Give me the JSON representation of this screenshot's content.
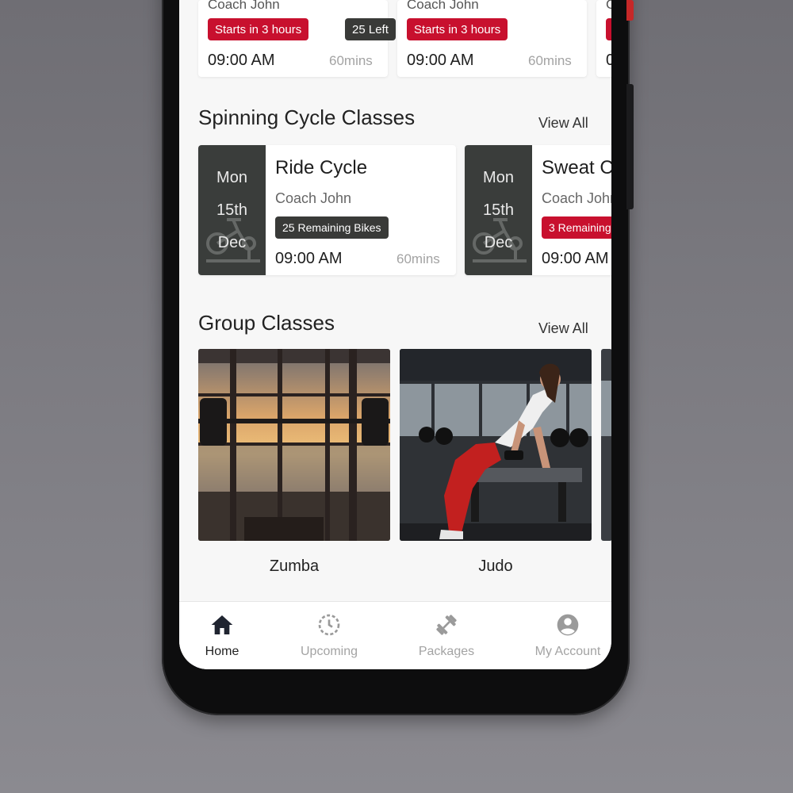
{
  "top_classes": [
    {
      "coach": "Coach John",
      "status_badge": "Starts in 3 hours",
      "spots_badge": "25 Left",
      "time": "09:00 AM",
      "duration": "60mins"
    },
    {
      "coach": "Coach John",
      "status_badge": "Starts in 3 hours",
      "time": "09:00 AM",
      "duration": "60mins"
    },
    {
      "coach": "C",
      "time": "0"
    }
  ],
  "spinning": {
    "title": "Spinning Cycle Classes",
    "view_all": "View All",
    "cards": [
      {
        "day": "Mon",
        "date": "15th",
        "month": "Dec",
        "name": "Ride Cycle",
        "coach": "Coach John",
        "badge": "25 Remaining Bikes",
        "badge_color": "#393a38",
        "time": "09:00 AM",
        "duration": "60mins"
      },
      {
        "day": "Mon",
        "date": "15th",
        "month": "Dec",
        "name": "Sweat C",
        "coach": "Coach John",
        "badge": "3 Remaining",
        "badge_color": "#c8102e",
        "time": "09:00 AM"
      }
    ]
  },
  "group": {
    "title": "Group Classes",
    "view_all": "View All",
    "items": [
      {
        "label": "Zumba"
      },
      {
        "label": "Judo"
      }
    ]
  },
  "nav": {
    "items": [
      {
        "label": "Home",
        "icon": "home-icon",
        "active": true
      },
      {
        "label": "Upcoming",
        "icon": "clock-icon"
      },
      {
        "label": "Packages",
        "icon": "dumbbell-icon"
      },
      {
        "label": "My Account",
        "icon": "account-icon"
      }
    ]
  },
  "colors": {
    "accent_red": "#c8102e",
    "dark": "#393a38",
    "date_block": "#3a3d3b"
  }
}
